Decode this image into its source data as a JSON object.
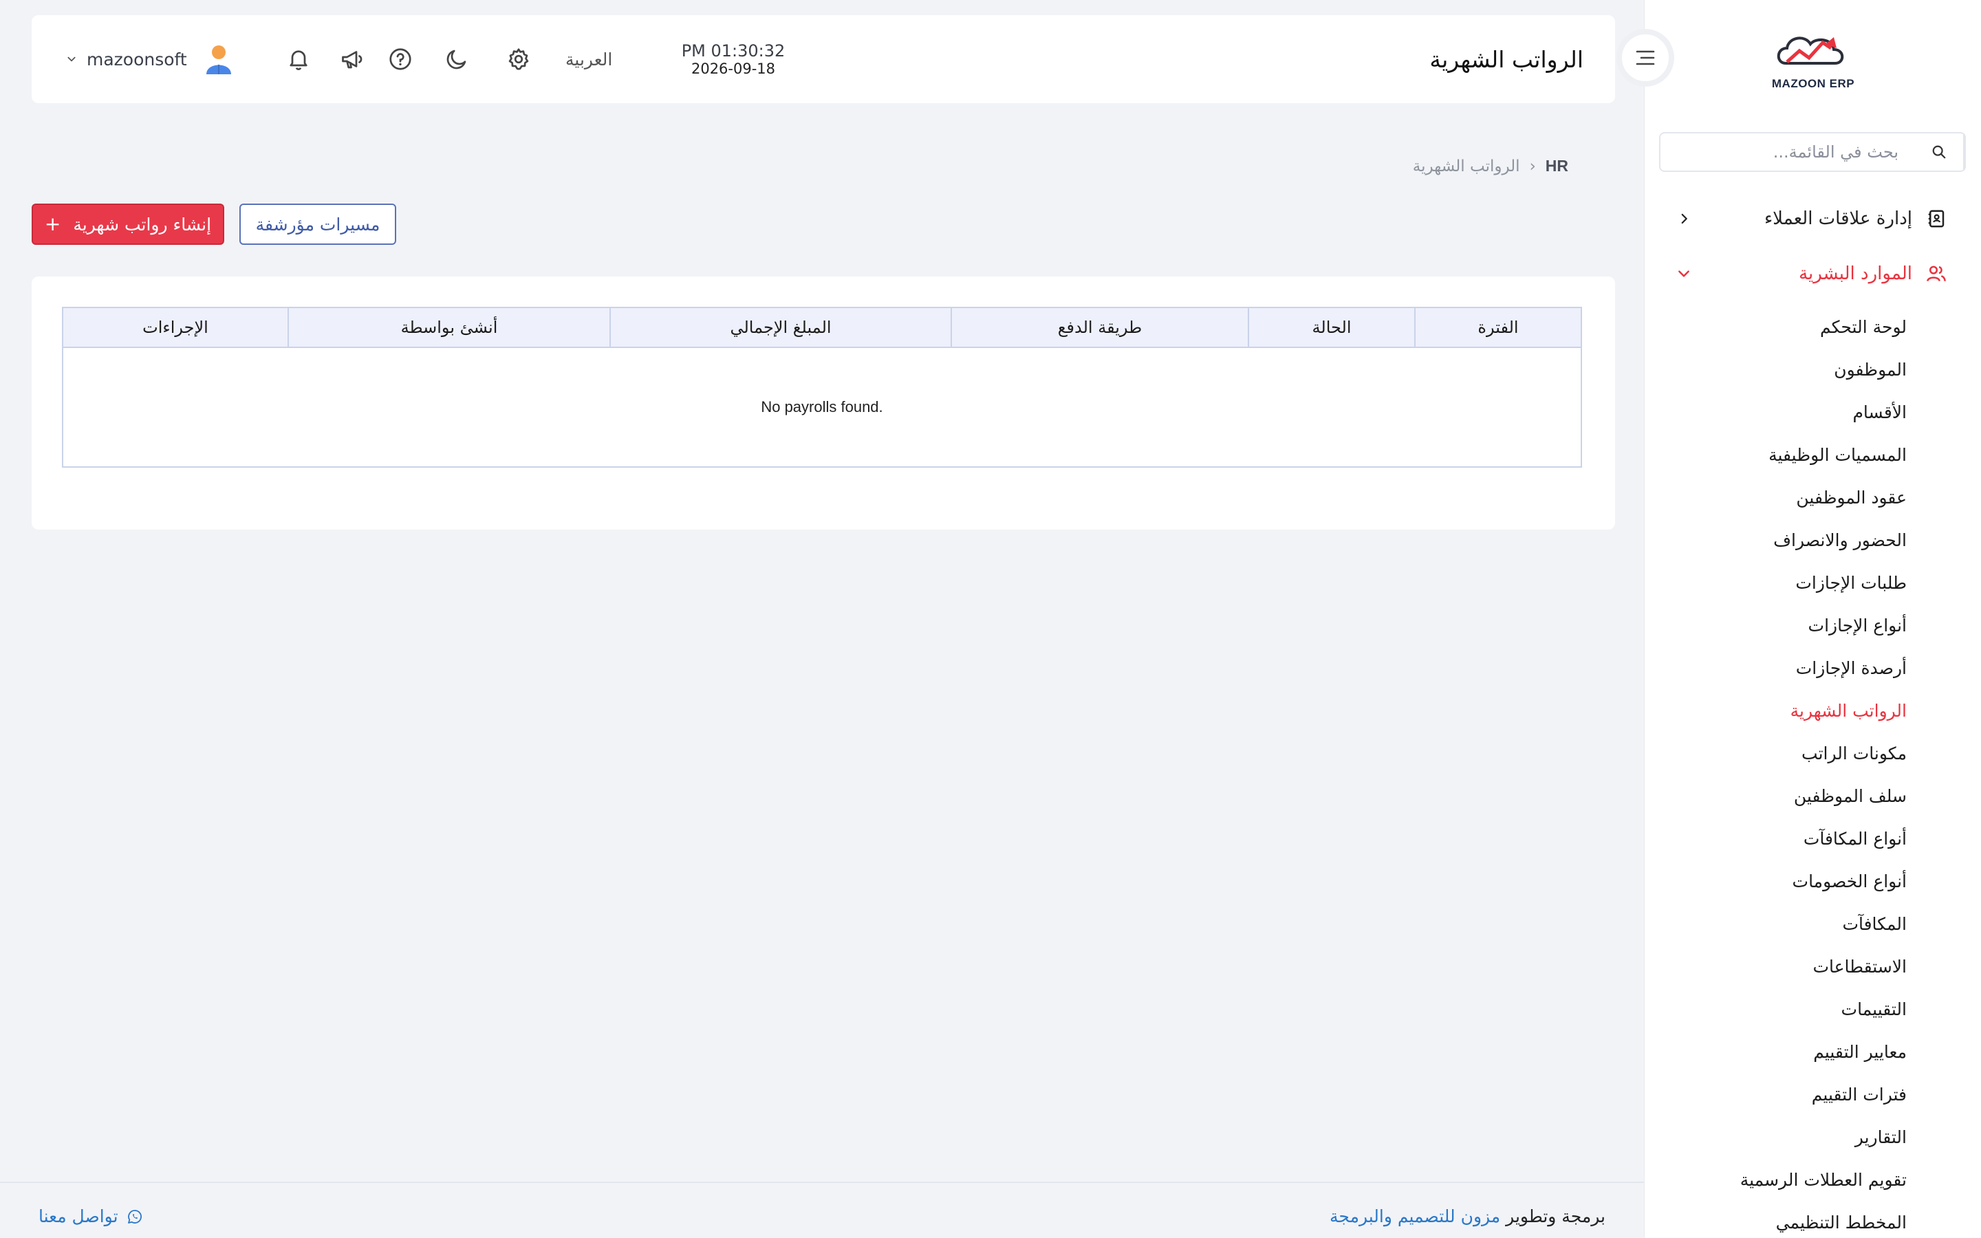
{
  "app": {
    "brand": "MAZOON ERP"
  },
  "sidebar": {
    "search_placeholder": "بحث في القائمة...",
    "groups": [
      {
        "label": "إدارة علاقات العملاء",
        "icon": "contacts-book-icon",
        "expanded": false
      },
      {
        "label": "الموارد البشرية",
        "icon": "users-icon",
        "expanded": true
      }
    ],
    "hr_items": [
      {
        "label": "لوحة التحكم"
      },
      {
        "label": "الموظفون"
      },
      {
        "label": "الأقسام"
      },
      {
        "label": "المسميات الوظيفية"
      },
      {
        "label": "عقود الموظفين"
      },
      {
        "label": "الحضور والانصراف"
      },
      {
        "label": "طلبات الإجازات"
      },
      {
        "label": "أنواع الإجازات"
      },
      {
        "label": "أرصدة الإجازات"
      },
      {
        "label": "الرواتب الشهرية",
        "active": true
      },
      {
        "label": "مكونات الراتب"
      },
      {
        "label": "سلف الموظفين"
      },
      {
        "label": "أنواع المكافآت"
      },
      {
        "label": "أنواع الخصومات"
      },
      {
        "label": "المكافآت"
      },
      {
        "label": "الاستقطاعات"
      },
      {
        "label": "التقييمات"
      },
      {
        "label": "معايير التقييم"
      },
      {
        "label": "فترات التقييم"
      },
      {
        "label": "التقارير"
      },
      {
        "label": "تقويم العطلات الرسمية"
      },
      {
        "label": "المخطط التنظيمي"
      }
    ]
  },
  "header": {
    "title": "الرواتب الشهرية",
    "time": "PM 01:30:32",
    "date": "2026-09-18",
    "language": "العربية",
    "username": "mazoonsoft"
  },
  "breadcrumb": {
    "root": "HR",
    "separator": "›",
    "current": "الرواتب الشهرية"
  },
  "actions": {
    "create_label": "إنشاء رواتب شهرية",
    "create_icon": "+",
    "archived_label": "مسيرات مؤرشفة"
  },
  "table": {
    "columns": [
      "الفترة",
      "الحالة",
      "طريقة الدفع",
      "المبلغ الإجمالي",
      "أنشئ بواسطة",
      "الإجراءات"
    ],
    "empty_message": "No payrolls found."
  },
  "footer": {
    "credit_prefix": "برمجة وتطوير ",
    "credit_link": "مزون للتصميم والبرمجة",
    "contact_label": "تواصل معنا"
  },
  "colors": {
    "accent": "#e8394a",
    "primary": "#3f5aa6",
    "link": "#2a78c8",
    "background": "#f1f3f7"
  }
}
